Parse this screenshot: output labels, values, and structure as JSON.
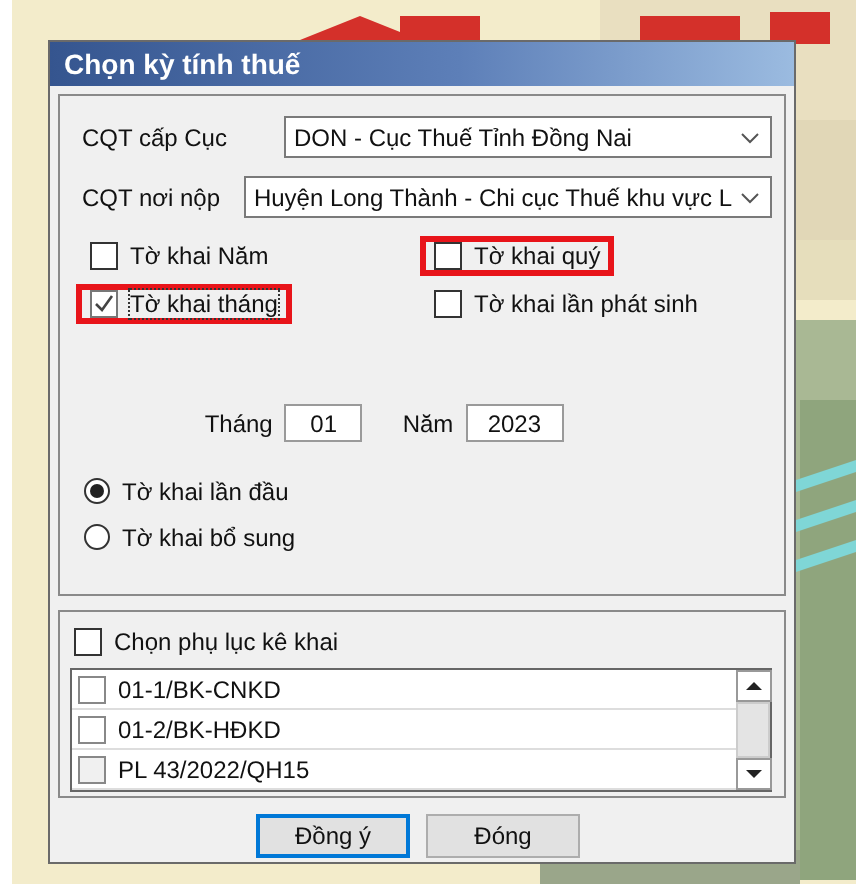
{
  "window": {
    "title": "Chọn kỳ tính thuế"
  },
  "fields": [
    {
      "label": "CQT cấp Cục",
      "value": "DON - Cục Thuế Tỉnh Đồng Nai"
    },
    {
      "label": "CQT nơi nộp",
      "value": "Huyện Long Thành - Chi cục Thuế khu vực L"
    }
  ],
  "declaration_types": [
    {
      "label": "Tờ khai Năm",
      "checked": false,
      "highlighted": false
    },
    {
      "label": "Tờ khai quý",
      "checked": false,
      "highlighted": true
    },
    {
      "label": "Tờ khai tháng",
      "checked": true,
      "highlighted": true
    },
    {
      "label": "Tờ khai lần phát sinh",
      "checked": false,
      "highlighted": false
    }
  ],
  "period": {
    "month_label": "Tháng",
    "month": "01",
    "year_label": "Năm",
    "year": "2023"
  },
  "submission": [
    {
      "label": "Tờ khai lần đầu",
      "selected": true
    },
    {
      "label": "Tờ khai bổ sung",
      "selected": false
    }
  ],
  "appendix": {
    "label": "Chọn phụ lục kê khai",
    "checked": false,
    "items": [
      {
        "label": "01-1/BK-CNKD",
        "checked": false
      },
      {
        "label": "01-2/BK-HĐKD",
        "checked": false
      },
      {
        "label": "PL 43/2022/QH15",
        "checked": false
      }
    ]
  },
  "buttons": [
    {
      "label": "Đồng ý",
      "focused": true
    },
    {
      "label": "Đóng",
      "focused": false
    }
  ]
}
